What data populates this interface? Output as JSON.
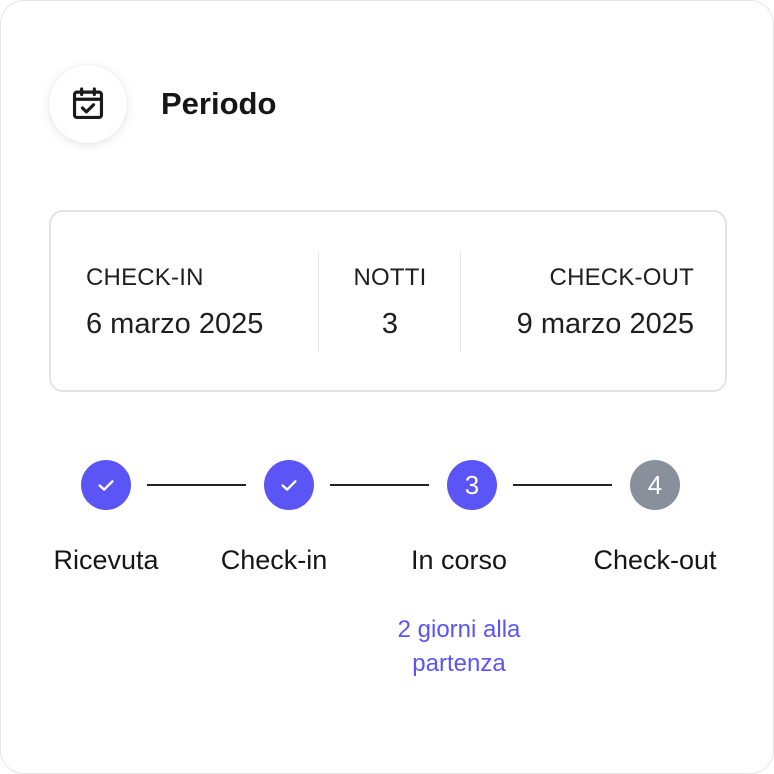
{
  "header": {
    "title": "Periodo",
    "icon": "calendar-check-icon"
  },
  "period": {
    "checkin_label": "CHECK-IN",
    "checkin_value": "6 marzo 2025",
    "nights_label": "NOTTI",
    "nights_value": "3",
    "checkout_label": "CHECK-OUT",
    "checkout_value": "9 marzo 2025"
  },
  "stepper": {
    "steps": [
      {
        "label": "Ricevuta",
        "state": "done",
        "marker": ""
      },
      {
        "label": "Check-in",
        "state": "done",
        "marker": ""
      },
      {
        "label": "In corso",
        "state": "current",
        "marker": "3"
      },
      {
        "label": "Check-out",
        "state": "upcoming",
        "marker": "4"
      }
    ],
    "current_note": "2 giorni alla partenza",
    "colors": {
      "accent": "#5b55f5",
      "upcoming": "#8a8f9c"
    }
  }
}
